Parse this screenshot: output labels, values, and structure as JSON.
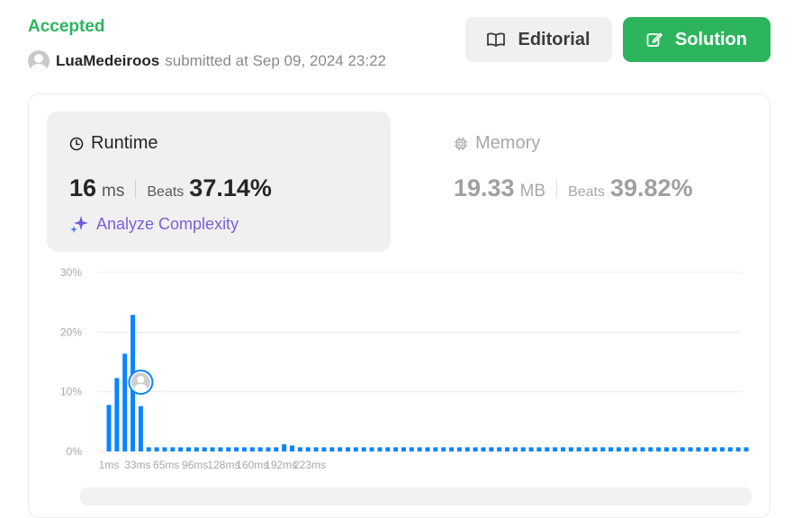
{
  "status": "Accepted",
  "submission": {
    "username": "LuaMedeiroos",
    "submitted_text": "submitted at Sep 09, 2024 23:22"
  },
  "buttons": {
    "editorial": "Editorial",
    "solution": "Solution"
  },
  "runtime": {
    "title": "Runtime",
    "value": "16",
    "unit": "ms",
    "beats_label": "Beats",
    "beats": "37.14%",
    "analyze": "Analyze Complexity"
  },
  "memory": {
    "title": "Memory",
    "value": "19.33",
    "unit": "MB",
    "beats_label": "Beats",
    "beats": "39.82%"
  },
  "colors": {
    "accent_green": "#2db55d",
    "bar_blue": "#0a84ff",
    "analyze_purple": "#7b61d8"
  },
  "chart_data": {
    "type": "bar",
    "y_ticks": [
      "0%",
      "10%",
      "20%",
      "30%"
    ],
    "ylim": [
      0,
      30
    ],
    "x_ticks": [
      "1ms",
      "33ms",
      "65ms",
      "96ms",
      "128ms",
      "160ms",
      "192ms",
      "223ms"
    ],
    "grid": true,
    "values": [
      7.8,
      12.3,
      16.4,
      22.9,
      7.6,
      0.7,
      0.7,
      0.7,
      0.7,
      0.7,
      0.7,
      0.7,
      0.7,
      0.7,
      0.7,
      0.7,
      0.7,
      0.7,
      0.7,
      0.7,
      0.7,
      0.7,
      1.2,
      1.0,
      0.7,
      0.7,
      0.7,
      0.7,
      0.7,
      0.7,
      0.7,
      0.7,
      0.7,
      0.7,
      0.7,
      0.7,
      0.7,
      0.7,
      0.7,
      0.7,
      0.7,
      0.7,
      0.7,
      0.7,
      0.7,
      0.7,
      0.7,
      0.7,
      0.7,
      0.7,
      0.7,
      0.7,
      0.7,
      0.7,
      0.7,
      0.7,
      0.7,
      0.7,
      0.7,
      0.7,
      0.7,
      0.7,
      0.7,
      0.7,
      0.7,
      0.7,
      0.7,
      0.7,
      0.7,
      0.7,
      0.7,
      0.7,
      0.7,
      0.7,
      0.7,
      0.7,
      0.7,
      0.7,
      0.7,
      0.7,
      0.7
    ],
    "marker_bar_index": 4
  }
}
